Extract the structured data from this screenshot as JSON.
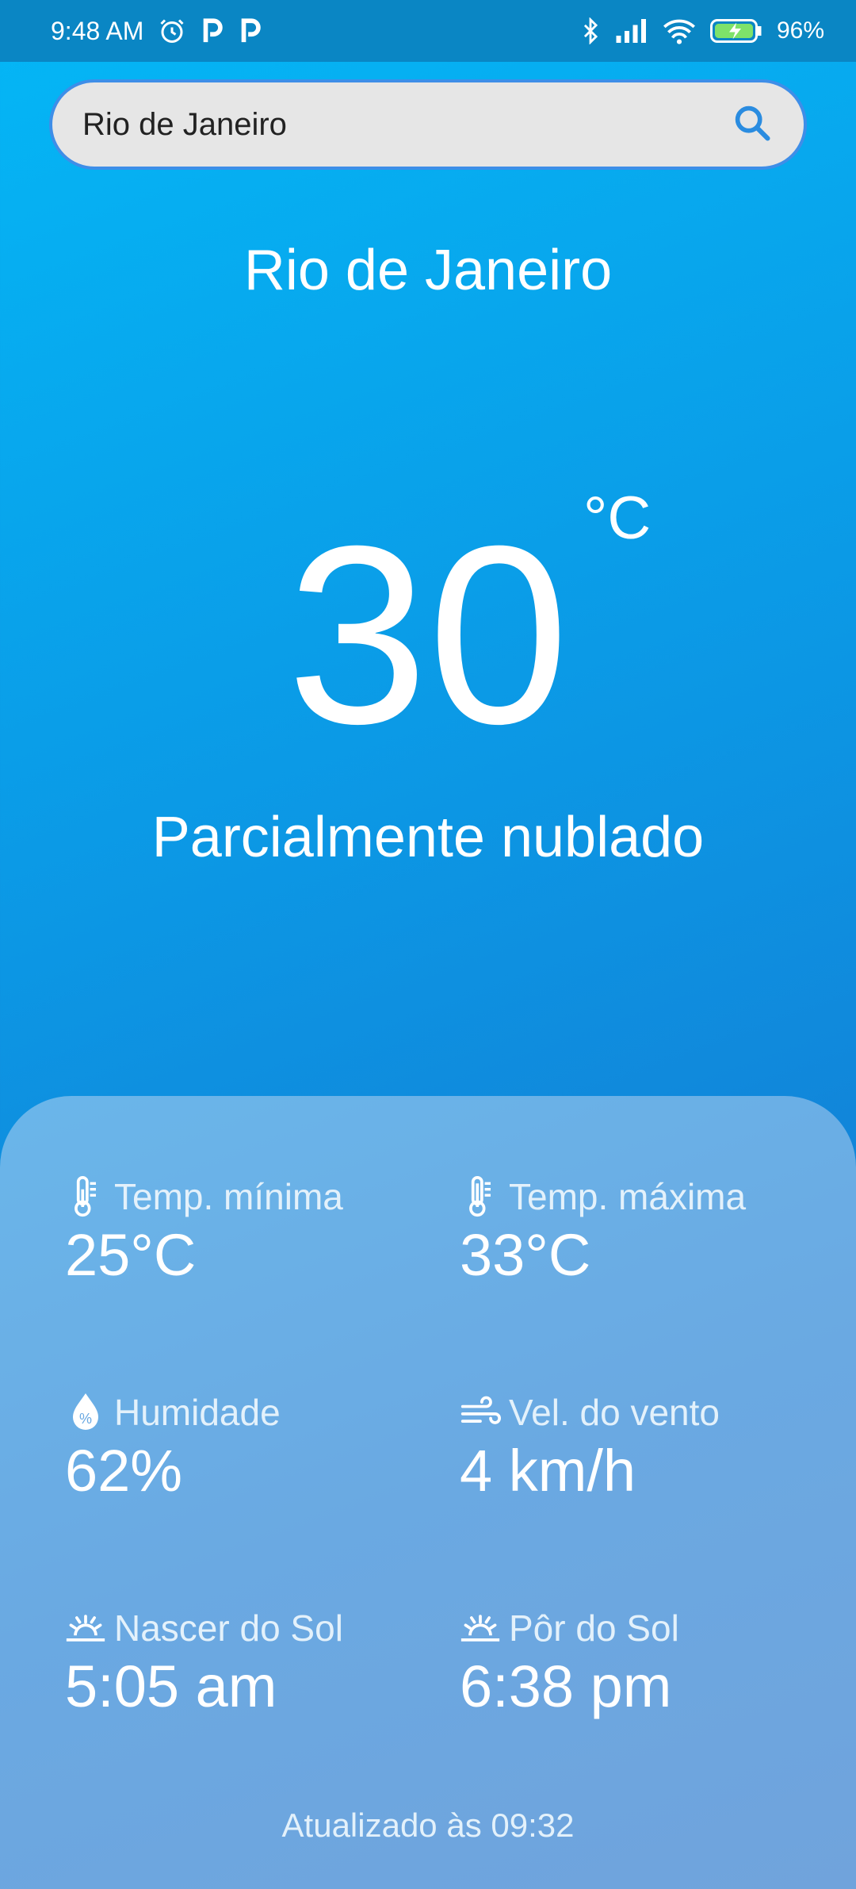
{
  "status_bar": {
    "time": "9:48 AM",
    "battery": "96%"
  },
  "search": {
    "value": "Rio de Janeiro",
    "placeholder": ""
  },
  "weather": {
    "city": "Rio de Janeiro",
    "temperature": "30",
    "unit": "°C",
    "condition": "Parcialmente nublado"
  },
  "details": {
    "temp_min_label": "Temp. mínima",
    "temp_min_value": "25°C",
    "temp_max_label": "Temp. máxima",
    "temp_max_value": "33°C",
    "humidity_label": "Humidade",
    "humidity_value": "62%",
    "wind_label": "Vel. do vento",
    "wind_value": "4 km/h",
    "sunrise_label": "Nascer do Sol",
    "sunrise_value": "5:05 am",
    "sunset_label": "Pôr do Sol",
    "sunset_value": "6:38 pm"
  },
  "footer": {
    "updated": "Atualizado às 09:32"
  },
  "colors": {
    "accent": "#3e8ee8",
    "background_top": "#04b7f6",
    "background_bottom": "#1b7ad3",
    "card": "#6aa9e2"
  }
}
